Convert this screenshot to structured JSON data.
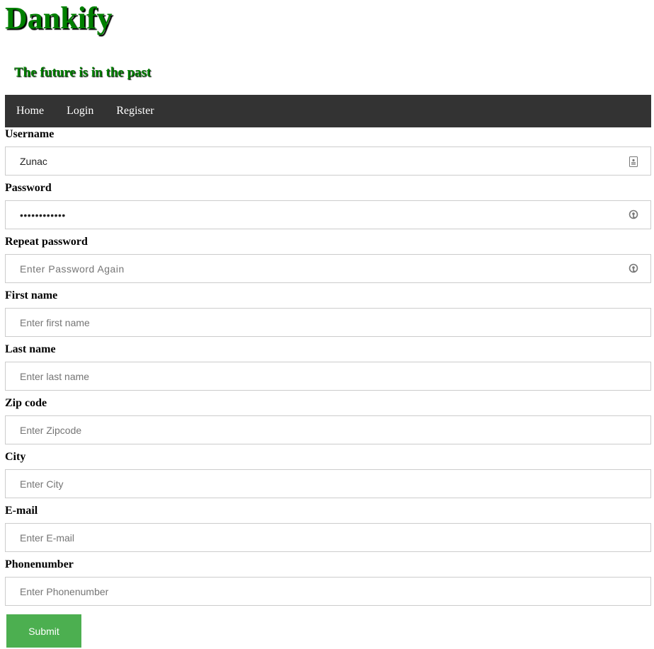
{
  "site": {
    "title": "Dankify",
    "tagline": "The future is in the past"
  },
  "nav": {
    "items": [
      {
        "label": "Home"
      },
      {
        "label": "Login"
      },
      {
        "label": "Register"
      }
    ]
  },
  "form": {
    "username": {
      "label": "Username",
      "value": "Zunac",
      "placeholder": "",
      "icon": "contact-card-icon"
    },
    "password": {
      "label": "Password",
      "value": "Password1234",
      "placeholder": "",
      "icon": "key-icon"
    },
    "repeat_password": {
      "label": "Repeat password",
      "value": "",
      "placeholder": "Enter Password Again",
      "icon": "key-icon"
    },
    "first_name": {
      "label": "First name",
      "value": "",
      "placeholder": "Enter first name"
    },
    "last_name": {
      "label": "Last name",
      "value": "",
      "placeholder": "Enter last name"
    },
    "zip_code": {
      "label": "Zip code",
      "value": "",
      "placeholder": "Enter Zipcode"
    },
    "city": {
      "label": "City",
      "value": "",
      "placeholder": "Enter City"
    },
    "email": {
      "label": "E-mail",
      "value": "",
      "placeholder": "Enter E-mail"
    },
    "phone": {
      "label": "Phonenumber",
      "value": "",
      "placeholder": "Enter Phonenumber"
    },
    "submit_label": "Submit"
  },
  "colors": {
    "brand": "#008000",
    "navbar": "#333333",
    "submit": "#4caf50"
  }
}
